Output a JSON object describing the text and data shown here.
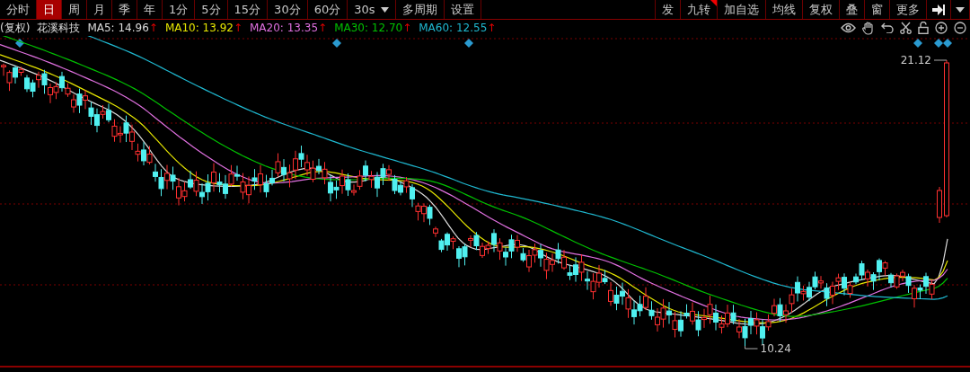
{
  "toolbar": {
    "periods": [
      {
        "label": "分时",
        "selected": false,
        "kind": "tab"
      },
      {
        "label": "日",
        "selected": true,
        "kind": "tab"
      },
      {
        "label": "周",
        "selected": false,
        "kind": "tab"
      },
      {
        "label": "月",
        "selected": false,
        "kind": "tab"
      },
      {
        "label": "季",
        "selected": false,
        "kind": "tab"
      },
      {
        "label": "年",
        "selected": false,
        "kind": "tab"
      },
      {
        "label": "1分",
        "selected": false,
        "kind": "tab"
      },
      {
        "label": "5分",
        "selected": false,
        "kind": "tab"
      },
      {
        "label": "15分",
        "selected": false,
        "kind": "tab"
      },
      {
        "label": "30分",
        "selected": false,
        "kind": "tab"
      },
      {
        "label": "60分",
        "selected": false,
        "kind": "tab"
      },
      {
        "label": "30s",
        "selected": false,
        "kind": "dropdown"
      },
      {
        "label": "多周期",
        "selected": false,
        "kind": "tab"
      },
      {
        "label": "设置",
        "selected": false,
        "kind": "tab"
      }
    ],
    "tools": [
      {
        "label": "发",
        "marked": false
      },
      {
        "label": "九转",
        "marked": true
      },
      {
        "label": "加自选",
        "marked": false
      },
      {
        "label": "均线",
        "marked": false
      },
      {
        "label": "复权",
        "marked": false
      },
      {
        "label": "叠",
        "marked": false
      },
      {
        "label": "窗",
        "marked": false
      },
      {
        "label": "更多",
        "marked": false
      }
    ]
  },
  "legend": {
    "adjust": "(复权)",
    "name": "花溪科技",
    "moving_averages": [
      {
        "label": "MA5:",
        "value": "14.96",
        "trend": "↑",
        "color": "#dcdcdc"
      },
      {
        "label": "MA10:",
        "value": "13.92",
        "trend": "↑",
        "color": "#e6e600"
      },
      {
        "label": "MA20:",
        "value": "13.35",
        "trend": "↑",
        "color": "#e070e0"
      },
      {
        "label": "MA30:",
        "value": "12.70",
        "trend": "↑",
        "color": "#00c000"
      },
      {
        "label": "MA60:",
        "value": "12.55",
        "trend": "↑",
        "color": "#1fb8d0"
      }
    ]
  },
  "chart": {
    "high_label": "21.12",
    "low_label": "10.24"
  }
}
